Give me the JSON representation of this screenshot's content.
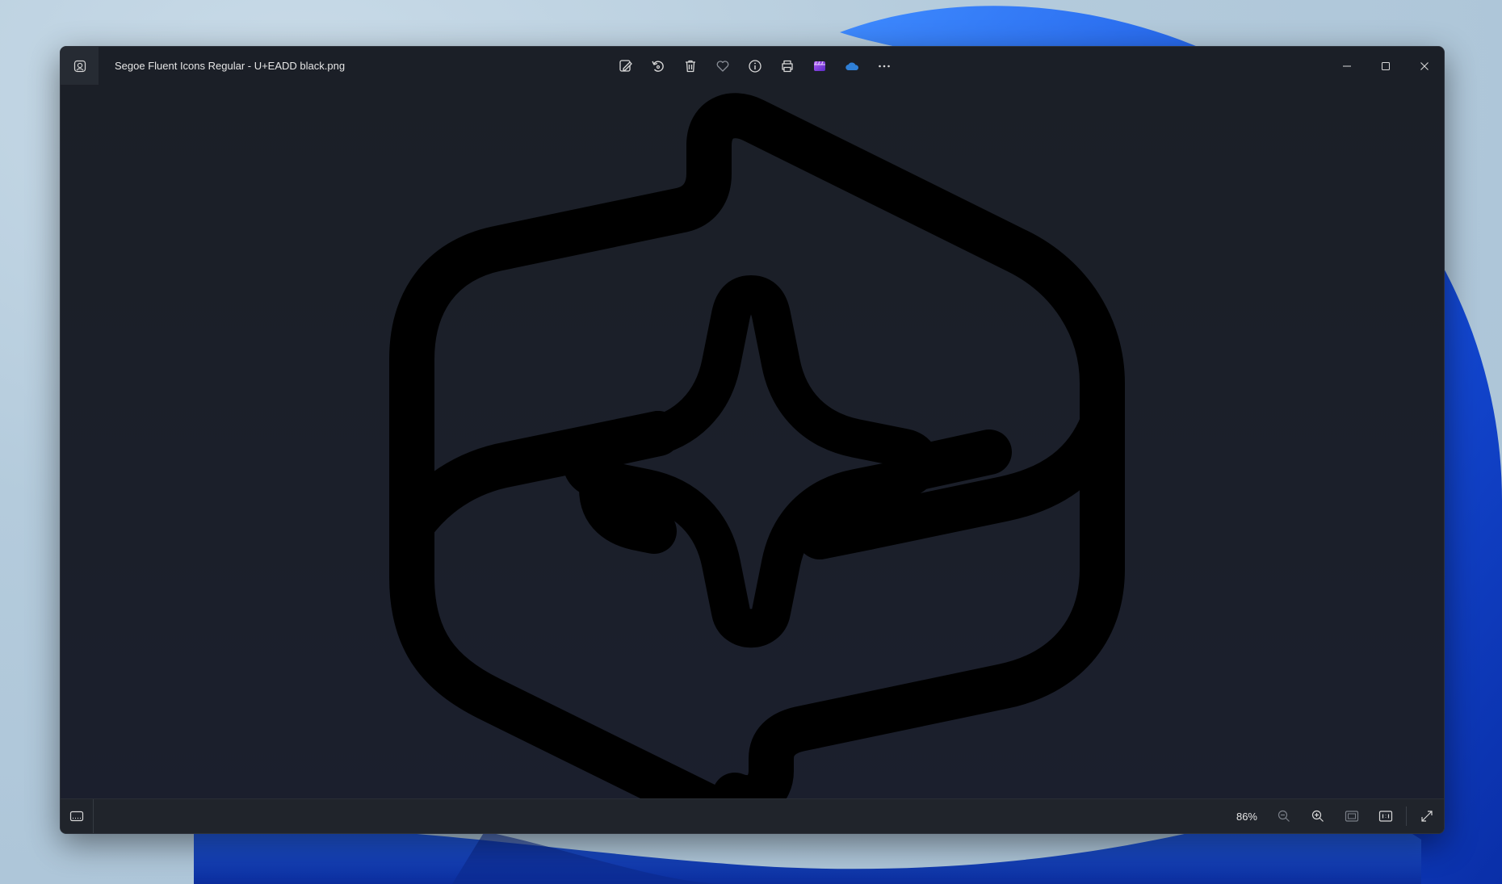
{
  "window": {
    "title": "Segoe Fluent Icons Regular - U+EADD black.png"
  },
  "toolbar": {
    "items": [
      {
        "icon": "edit-image-icon"
      },
      {
        "icon": "rotate-icon"
      },
      {
        "icon": "delete-icon"
      },
      {
        "icon": "favorite-heart-icon"
      },
      {
        "icon": "info-icon"
      },
      {
        "icon": "print-icon"
      },
      {
        "icon": "clipchamp-icon"
      },
      {
        "icon": "onedrive-icon"
      },
      {
        "icon": "more-options-icon"
      }
    ]
  },
  "statusbar": {
    "zoom": "86%"
  },
  "colors": {
    "window_bg": "#1b1f27",
    "glyph": "#000000",
    "text": "#e6e6e6",
    "onedrive": "#2f7fd6",
    "clipchamp": "#8f4ce0"
  }
}
